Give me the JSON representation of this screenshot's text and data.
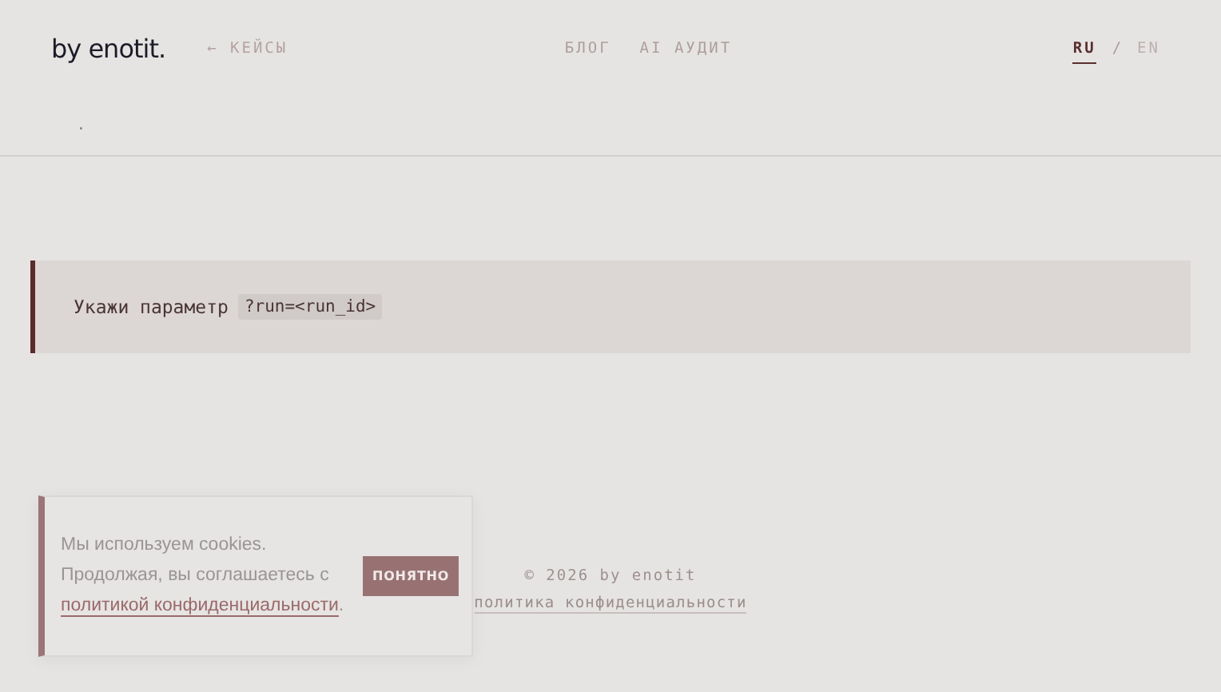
{
  "header": {
    "logo": "by enotit.",
    "back_link": "← КЕЙСЫ",
    "nav": [
      "БЛОГ",
      "AI АУДИТ"
    ],
    "languages": [
      {
        "label": "RU",
        "selected": true
      },
      {
        "label": "EN",
        "selected": false
      }
    ],
    "separator": "/"
  },
  "breadcrumb": ".",
  "notice": {
    "text": "Укажи параметр",
    "code": "?run=<run_id>"
  },
  "footer": {
    "copyright": "© 2026 by enotit",
    "policy_link": "политика конфиденциальности"
  },
  "cookie_banner": {
    "text": "Мы используем cookies. Продолжая, вы соглашаетесь с",
    "link": "политикой конфиденциальности",
    "end": ".",
    "button": "ПОНЯТНО"
  }
}
